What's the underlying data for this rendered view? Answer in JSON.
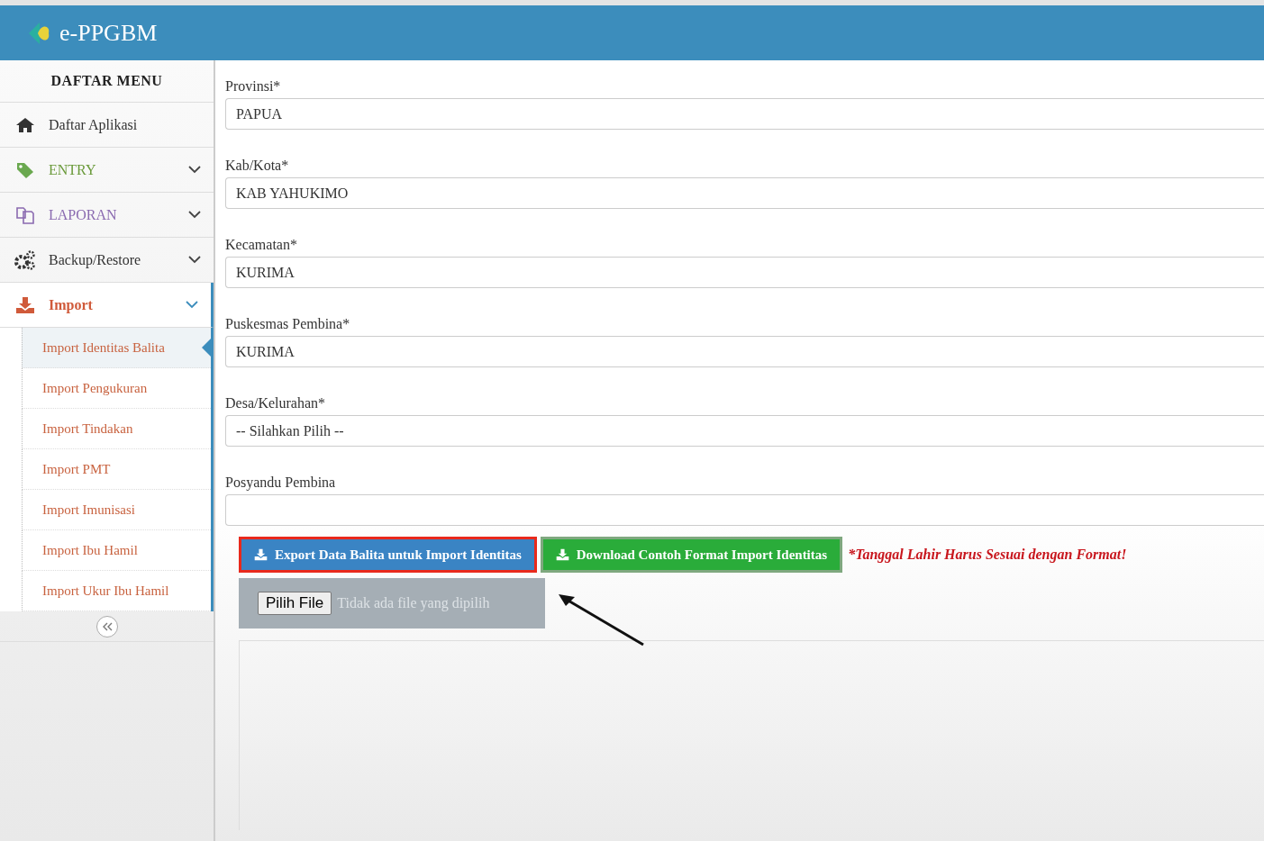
{
  "header": {
    "title": "e-PPGBM"
  },
  "sidebar": {
    "title": "DAFTAR MENU",
    "items": [
      {
        "label": "Daftar Aplikasi",
        "kind": "link",
        "color": "#333333"
      },
      {
        "label": "ENTRY",
        "kind": "group",
        "expanded": false,
        "color": "#6a9a3a"
      },
      {
        "label": "LAPORAN",
        "kind": "group",
        "expanded": false,
        "color": "#8a6ab0"
      },
      {
        "label": "Backup/Restore",
        "kind": "group",
        "expanded": false,
        "color": "#333333"
      },
      {
        "label": "Import",
        "kind": "group",
        "expanded": true,
        "color": "#d05a3a",
        "children": [
          {
            "label": "Import Identitas Balita",
            "selected": true
          },
          {
            "label": "Import Pengukuran",
            "selected": false
          },
          {
            "label": "Import Tindakan",
            "selected": false
          },
          {
            "label": "Import PMT",
            "selected": false
          },
          {
            "label": "Import Imunisasi",
            "selected": false
          },
          {
            "label": "Import Ibu Hamil",
            "selected": false
          },
          {
            "label": "Import Ukur Ibu Hamil",
            "selected": false
          }
        ]
      }
    ]
  },
  "form": {
    "fields": [
      {
        "label": "Provinsi*",
        "value": "PAPUA"
      },
      {
        "label": "Kab/Kota*",
        "value": "KAB YAHUKIMO"
      },
      {
        "label": "Kecamatan*",
        "value": "KURIMA"
      },
      {
        "label": "Puskesmas Pembina*",
        "value": "KURIMA"
      },
      {
        "label": "Desa/Kelurahan*",
        "value": "-- Silahkan Pilih --"
      },
      {
        "label": "Posyandu Pembina"
      }
    ],
    "buttons": [
      {
        "label": "Export Data Balita untuk Import Identitas",
        "kind": "primary",
        "highlighted": true
      },
      {
        "label": "Download Contoh Format Import Identitas",
        "kind": "success",
        "highlighted": false
      }
    ],
    "note": "*Tanggal Lahir Harus Sesuai dengan Format!",
    "file": {
      "button": "Pilih File",
      "status": "Tidak ada file yang dipilih"
    }
  }
}
